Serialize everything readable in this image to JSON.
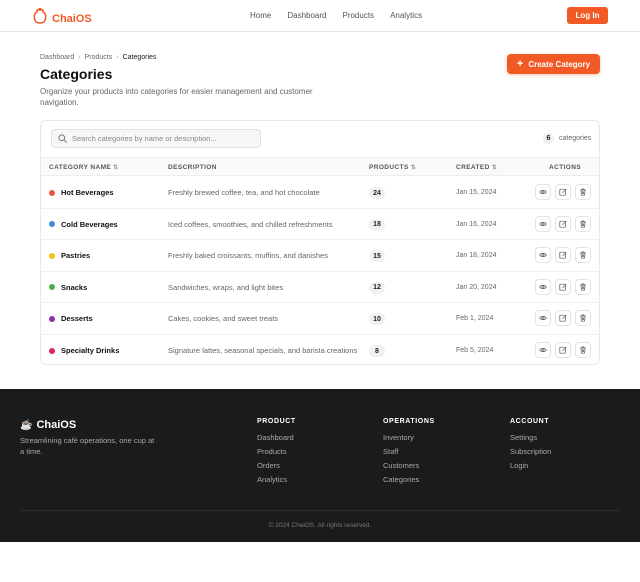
{
  "nav": {
    "brand": "ChaiOS",
    "links": [
      "Home",
      "Dashboard",
      "Products",
      "Analytics"
    ],
    "login_label": "Log In",
    "accent": "#f15a24"
  },
  "header": {
    "breadcrumb": [
      "Dashboard",
      "Products",
      "Categories"
    ],
    "title": "Categories",
    "description": "Organize your products into categories for easier management and customer navigation.",
    "create_label": "Create Category"
  },
  "toolbar": {
    "search_placeholder": "Search categories by name or description...",
    "count": "6",
    "count_label": "categories"
  },
  "table": {
    "columns": [
      "CATEGORY NAME",
      "DESCRIPTION",
      "PRODUCTS",
      "CREATED",
      "ACTIONS"
    ],
    "rows": [
      {
        "name": "Hot Beverages",
        "color": "#e8553a",
        "description": "Freshly brewed coffee, tea, and hot chocolate",
        "products": "24",
        "created": "Jan 15, 2024"
      },
      {
        "name": "Cold Beverages",
        "color": "#3b8fd9",
        "description": "Iced coffees, smoothies, and chilled refreshments",
        "products": "18",
        "created": "Jan 16, 2024"
      },
      {
        "name": "Pastries",
        "color": "#f0c21d",
        "description": "Freshly baked croissants, muffins, and danishes",
        "products": "15",
        "created": "Jan 18, 2024"
      },
      {
        "name": "Snacks",
        "color": "#4caf50",
        "description": "Sandwiches, wraps, and light bites",
        "products": "12",
        "created": "Jan 20, 2024"
      },
      {
        "name": "Desserts",
        "color": "#8e2fa8",
        "description": "Cakes, cookies, and sweet treats",
        "products": "10",
        "created": "Feb 1, 2024"
      },
      {
        "name": "Specialty Drinks",
        "color": "#e0245e",
        "description": "Signature lattes, seasonal specials, and barista creations",
        "products": "8",
        "created": "Feb 5, 2024"
      }
    ]
  },
  "footer": {
    "brand": "ChaiOS",
    "tagline": "Streamlining café operations, one cup at a time.",
    "columns": [
      {
        "title": "PRODUCT",
        "links": [
          "Dashboard",
          "Products",
          "Orders",
          "Analytics"
        ]
      },
      {
        "title": "OPERATIONS",
        "links": [
          "Inventory",
          "Staff",
          "Customers",
          "Categories"
        ]
      },
      {
        "title": "ACCOUNT",
        "links": [
          "Settings",
          "Subscription",
          "Login"
        ]
      }
    ],
    "copyright": "© 2024 ChaiOS. All rights reserved."
  }
}
